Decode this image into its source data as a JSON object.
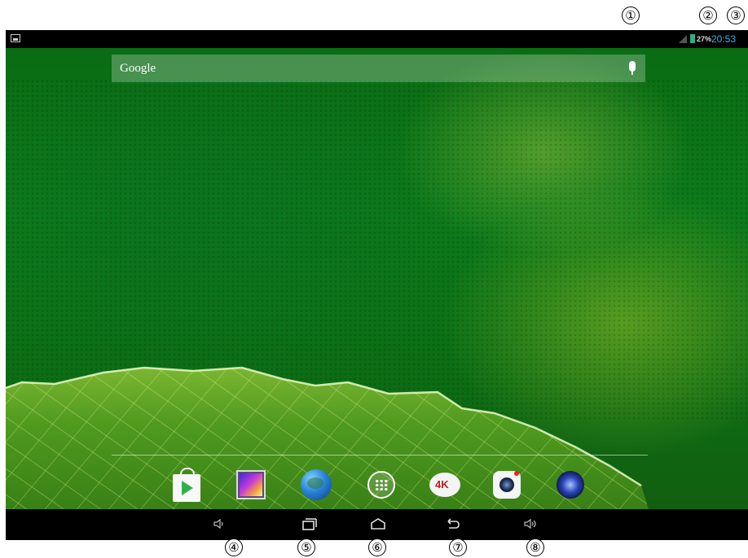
{
  "callouts": {
    "c1": "①",
    "c2": "②",
    "c3": "③",
    "c4": "④",
    "c5": "⑤",
    "c6": "⑥",
    "c7": "⑦",
    "c8": "⑧"
  },
  "status_bar": {
    "battery_percent": "27%",
    "time": "20:53",
    "icons": [
      "picture-notification-icon",
      "signal-icon",
      "battery-icon"
    ],
    "clock_color": "#33b5e5"
  },
  "search": {
    "label": "Google",
    "icon": "microphone-icon"
  },
  "dock": {
    "apps": [
      {
        "name": "play-store-icon"
      },
      {
        "name": "gallery-icon"
      },
      {
        "name": "browser-icon"
      },
      {
        "name": "app-drawer-icon"
      },
      {
        "name": "4k-player-icon",
        "badge_text": "4K"
      },
      {
        "name": "camera-icon"
      },
      {
        "name": "music-icon"
      }
    ]
  },
  "navigation": {
    "buttons": [
      "volume-down-icon",
      "recent-apps-icon",
      "home-icon",
      "back-icon",
      "volume-up-icon"
    ]
  }
}
